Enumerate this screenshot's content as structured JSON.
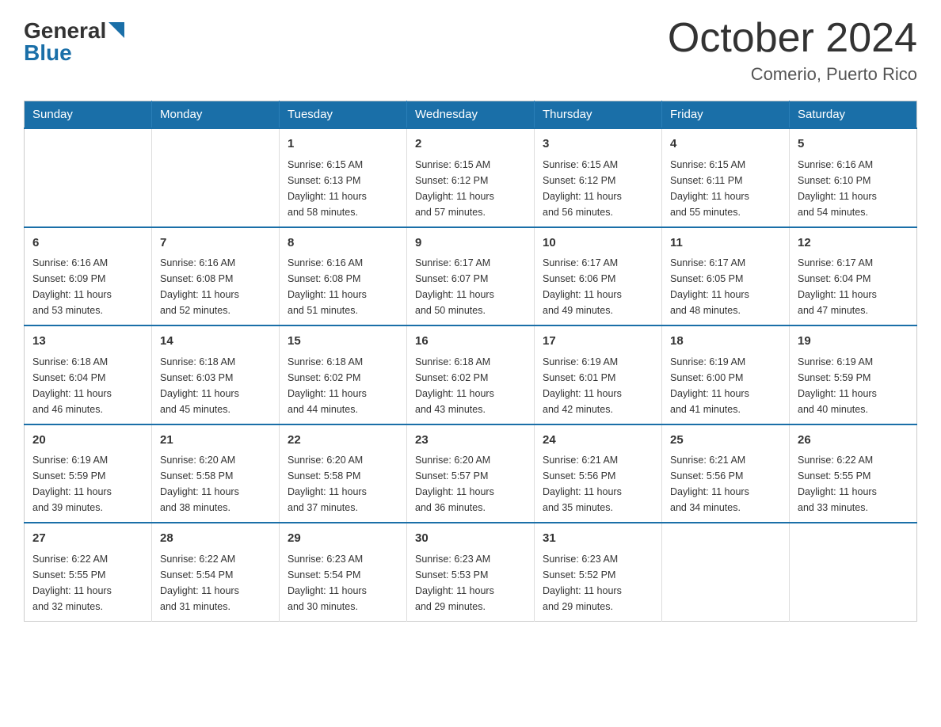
{
  "header": {
    "logo_general": "General",
    "logo_blue": "Blue",
    "month_title": "October 2024",
    "location": "Comerio, Puerto Rico"
  },
  "days_of_week": [
    "Sunday",
    "Monday",
    "Tuesday",
    "Wednesday",
    "Thursday",
    "Friday",
    "Saturday"
  ],
  "weeks": [
    [
      {
        "day": "",
        "info": ""
      },
      {
        "day": "",
        "info": ""
      },
      {
        "day": "1",
        "info": "Sunrise: 6:15 AM\nSunset: 6:13 PM\nDaylight: 11 hours\nand 58 minutes."
      },
      {
        "day": "2",
        "info": "Sunrise: 6:15 AM\nSunset: 6:12 PM\nDaylight: 11 hours\nand 57 minutes."
      },
      {
        "day": "3",
        "info": "Sunrise: 6:15 AM\nSunset: 6:12 PM\nDaylight: 11 hours\nand 56 minutes."
      },
      {
        "day": "4",
        "info": "Sunrise: 6:15 AM\nSunset: 6:11 PM\nDaylight: 11 hours\nand 55 minutes."
      },
      {
        "day": "5",
        "info": "Sunrise: 6:16 AM\nSunset: 6:10 PM\nDaylight: 11 hours\nand 54 minutes."
      }
    ],
    [
      {
        "day": "6",
        "info": "Sunrise: 6:16 AM\nSunset: 6:09 PM\nDaylight: 11 hours\nand 53 minutes."
      },
      {
        "day": "7",
        "info": "Sunrise: 6:16 AM\nSunset: 6:08 PM\nDaylight: 11 hours\nand 52 minutes."
      },
      {
        "day": "8",
        "info": "Sunrise: 6:16 AM\nSunset: 6:08 PM\nDaylight: 11 hours\nand 51 minutes."
      },
      {
        "day": "9",
        "info": "Sunrise: 6:17 AM\nSunset: 6:07 PM\nDaylight: 11 hours\nand 50 minutes."
      },
      {
        "day": "10",
        "info": "Sunrise: 6:17 AM\nSunset: 6:06 PM\nDaylight: 11 hours\nand 49 minutes."
      },
      {
        "day": "11",
        "info": "Sunrise: 6:17 AM\nSunset: 6:05 PM\nDaylight: 11 hours\nand 48 minutes."
      },
      {
        "day": "12",
        "info": "Sunrise: 6:17 AM\nSunset: 6:04 PM\nDaylight: 11 hours\nand 47 minutes."
      }
    ],
    [
      {
        "day": "13",
        "info": "Sunrise: 6:18 AM\nSunset: 6:04 PM\nDaylight: 11 hours\nand 46 minutes."
      },
      {
        "day": "14",
        "info": "Sunrise: 6:18 AM\nSunset: 6:03 PM\nDaylight: 11 hours\nand 45 minutes."
      },
      {
        "day": "15",
        "info": "Sunrise: 6:18 AM\nSunset: 6:02 PM\nDaylight: 11 hours\nand 44 minutes."
      },
      {
        "day": "16",
        "info": "Sunrise: 6:18 AM\nSunset: 6:02 PM\nDaylight: 11 hours\nand 43 minutes."
      },
      {
        "day": "17",
        "info": "Sunrise: 6:19 AM\nSunset: 6:01 PM\nDaylight: 11 hours\nand 42 minutes."
      },
      {
        "day": "18",
        "info": "Sunrise: 6:19 AM\nSunset: 6:00 PM\nDaylight: 11 hours\nand 41 minutes."
      },
      {
        "day": "19",
        "info": "Sunrise: 6:19 AM\nSunset: 5:59 PM\nDaylight: 11 hours\nand 40 minutes."
      }
    ],
    [
      {
        "day": "20",
        "info": "Sunrise: 6:19 AM\nSunset: 5:59 PM\nDaylight: 11 hours\nand 39 minutes."
      },
      {
        "day": "21",
        "info": "Sunrise: 6:20 AM\nSunset: 5:58 PM\nDaylight: 11 hours\nand 38 minutes."
      },
      {
        "day": "22",
        "info": "Sunrise: 6:20 AM\nSunset: 5:58 PM\nDaylight: 11 hours\nand 37 minutes."
      },
      {
        "day": "23",
        "info": "Sunrise: 6:20 AM\nSunset: 5:57 PM\nDaylight: 11 hours\nand 36 minutes."
      },
      {
        "day": "24",
        "info": "Sunrise: 6:21 AM\nSunset: 5:56 PM\nDaylight: 11 hours\nand 35 minutes."
      },
      {
        "day": "25",
        "info": "Sunrise: 6:21 AM\nSunset: 5:56 PM\nDaylight: 11 hours\nand 34 minutes."
      },
      {
        "day": "26",
        "info": "Sunrise: 6:22 AM\nSunset: 5:55 PM\nDaylight: 11 hours\nand 33 minutes."
      }
    ],
    [
      {
        "day": "27",
        "info": "Sunrise: 6:22 AM\nSunset: 5:55 PM\nDaylight: 11 hours\nand 32 minutes."
      },
      {
        "day": "28",
        "info": "Sunrise: 6:22 AM\nSunset: 5:54 PM\nDaylight: 11 hours\nand 31 minutes."
      },
      {
        "day": "29",
        "info": "Sunrise: 6:23 AM\nSunset: 5:54 PM\nDaylight: 11 hours\nand 30 minutes."
      },
      {
        "day": "30",
        "info": "Sunrise: 6:23 AM\nSunset: 5:53 PM\nDaylight: 11 hours\nand 29 minutes."
      },
      {
        "day": "31",
        "info": "Sunrise: 6:23 AM\nSunset: 5:52 PM\nDaylight: 11 hours\nand 29 minutes."
      },
      {
        "day": "",
        "info": ""
      },
      {
        "day": "",
        "info": ""
      }
    ]
  ]
}
